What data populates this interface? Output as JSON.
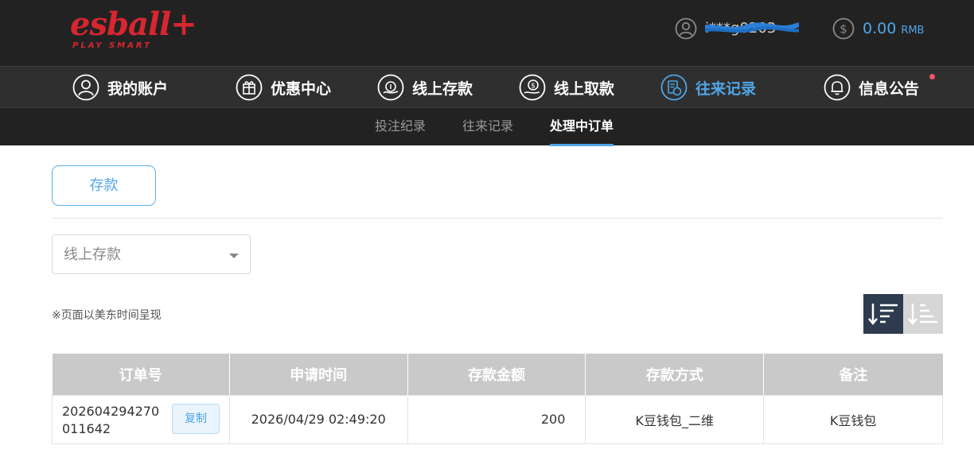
{
  "brand": {
    "logo_text": "esball+",
    "logo_tagline": "PLAY SMART",
    "logo_color": "#d8262f"
  },
  "header": {
    "username": "i***g0203",
    "balance_amount": "0.00",
    "balance_currency": "RMB"
  },
  "main_nav": [
    {
      "label": "我的账户",
      "icon": "user-icon"
    },
    {
      "label": "优惠中心",
      "icon": "gift-icon"
    },
    {
      "label": "线上存款",
      "icon": "deposit-icon"
    },
    {
      "label": "线上取款",
      "icon": "withdraw-icon"
    },
    {
      "label": "往来记录",
      "icon": "records-icon",
      "active": true
    },
    {
      "label": "信息公告",
      "icon": "bell-icon",
      "has_notification": true
    }
  ],
  "sub_nav": [
    {
      "label": "投注纪录"
    },
    {
      "label": "往来记录"
    },
    {
      "label": "处理中订单",
      "active": true
    }
  ],
  "content": {
    "tab_label": "存款",
    "filter_select_value": "线上存款",
    "timezone_note": "※页面以美东时间呈现"
  },
  "table": {
    "columns": [
      "订单号",
      "申请时间",
      "存款金额",
      "存款方式",
      "备注"
    ],
    "rows": [
      {
        "order_no": "202604294270011642",
        "copy_label": "复制",
        "time": "2026/04/29 02:49:20",
        "amount": "200",
        "method": "K豆钱包_二维",
        "remark": "K豆钱包"
      }
    ]
  },
  "colors": {
    "accent": "#4ea6e8",
    "header_bg": "#222222",
    "nav_bg": "#2f2f2f",
    "table_header_bg": "#c9c9c9",
    "sort_active_bg": "#2e3b4e",
    "notification_dot": "#f0566a"
  }
}
